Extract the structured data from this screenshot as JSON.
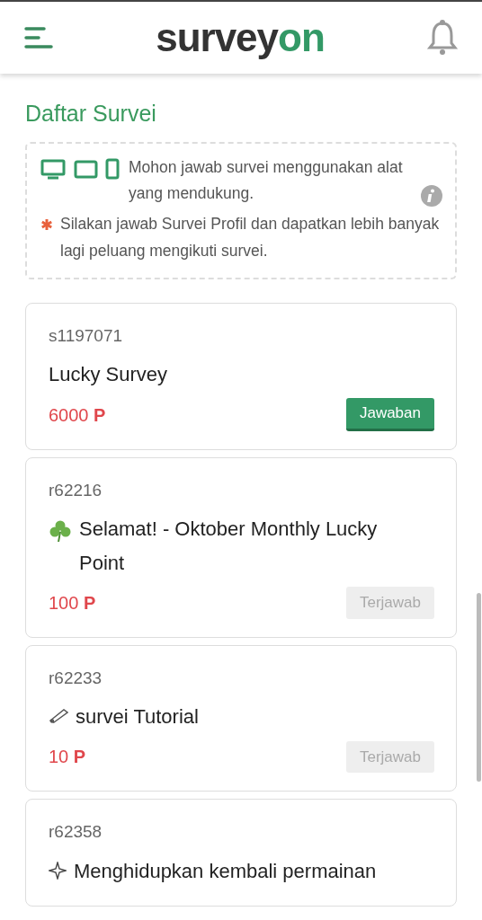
{
  "header": {
    "logo_main": "survey",
    "logo_accent": "on"
  },
  "page_title": "Daftar Survei",
  "notice": {
    "device_text": "Mohon jawab survei menggunakan alat yang mendukung.",
    "profile_text": "Silakan jawab Survei Profil dan dapatkan lebih banyak lagi peluang mengikuti survei."
  },
  "surveys": [
    {
      "id": "s1197071",
      "title": "Lucky Survey",
      "points": "6000",
      "unit": "P",
      "button": "Jawaban",
      "answered": false
    },
    {
      "id": "r62216",
      "kind": "clover",
      "title": "Selamat! - Oktober Monthly Lucky Point",
      "points": "100",
      "unit": "P",
      "button": "Terjawab",
      "answered": true
    },
    {
      "id": "r62233",
      "kind": "pencil",
      "title": "survei Tutorial",
      "points": "10",
      "unit": "P",
      "button": "Terjawab",
      "answered": true
    },
    {
      "id": "r62358",
      "kind": "sparkle",
      "title": "Menghidupkan kembali permainan"
    }
  ]
}
